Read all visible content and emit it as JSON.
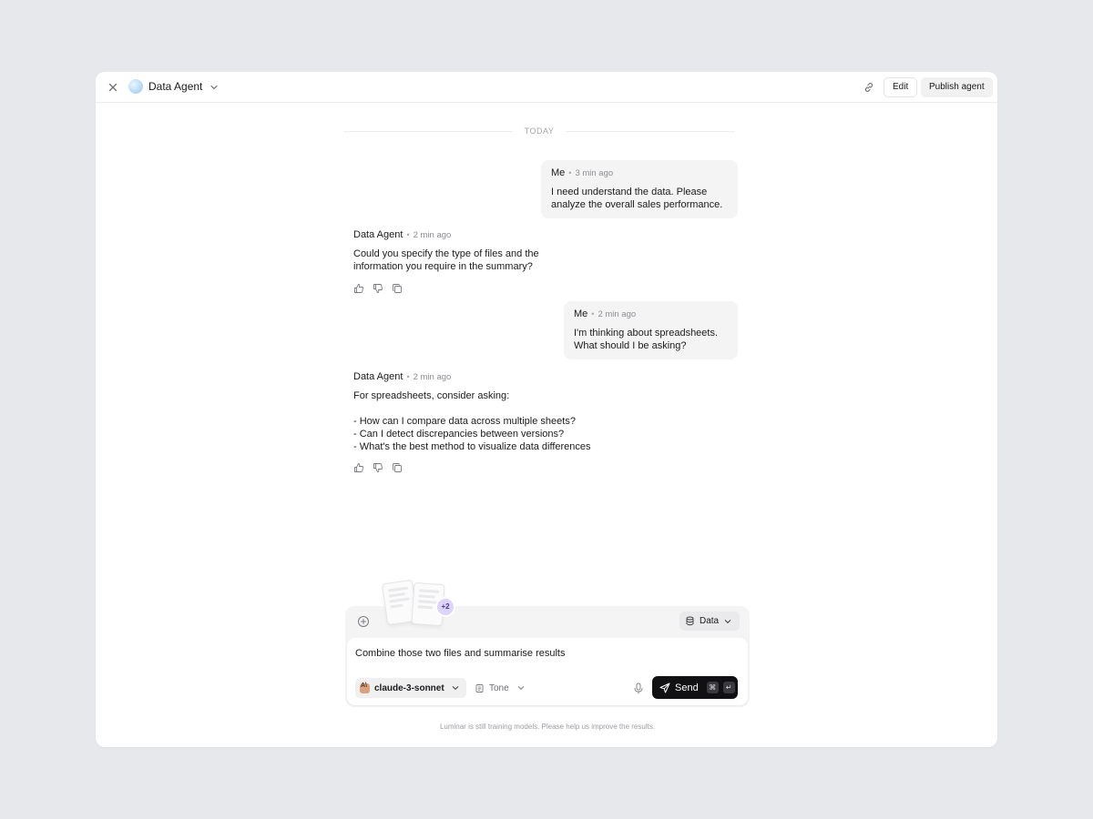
{
  "header": {
    "title": "Data Agent",
    "edit_label": "Edit",
    "publish_label": "Publish agent"
  },
  "conversation": {
    "day_label": "TODAY",
    "messages": [
      {
        "author": "Me",
        "time": "3 min ago",
        "text": "I need understand the data. Please\nanalyze the overall sales performance."
      },
      {
        "author": "Data Agent",
        "time": "2 min ago",
        "text": "Could you specify the type of files and the\ninformation you require in the summary?"
      },
      {
        "author": "Me",
        "time": "2 min ago",
        "text": "I'm thinking about spreadsheets.\nWhat should I be asking?"
      },
      {
        "author": "Data Agent",
        "time": "2 min ago",
        "text": "For spreadsheets, consider asking:\n\n- How can I compare data across multiple sheets?\n- Can I detect discrepancies between versions?\n- What's the best method to visualize data differences"
      }
    ]
  },
  "composer": {
    "attachment_count_label": "+2",
    "source_label": "Data",
    "prompt_value": "Combine those two files and summarise results",
    "model_label": "claude-3-sonnet",
    "tone_label": "Tone",
    "send_label": "Send",
    "shortcut_cmd": "⌘",
    "shortcut_enter": "↵"
  },
  "footer": {
    "note": "Luminar is still training models. Please help us improve the results."
  },
  "icons": [
    "close-icon",
    "agent-avatar",
    "chevron-down-icon",
    "link-icon",
    "thumbs-up-icon",
    "thumbs-down-icon",
    "copy-icon",
    "plus-circle-icon",
    "database-icon",
    "model-logo",
    "tone-icon",
    "microphone-icon",
    "send-icon"
  ],
  "colors": {
    "background": "#e7e8eb",
    "window": "#ffffff",
    "bubble": "#f4f4f5",
    "send_button": "#111113",
    "badge": "#ddd3fb"
  }
}
